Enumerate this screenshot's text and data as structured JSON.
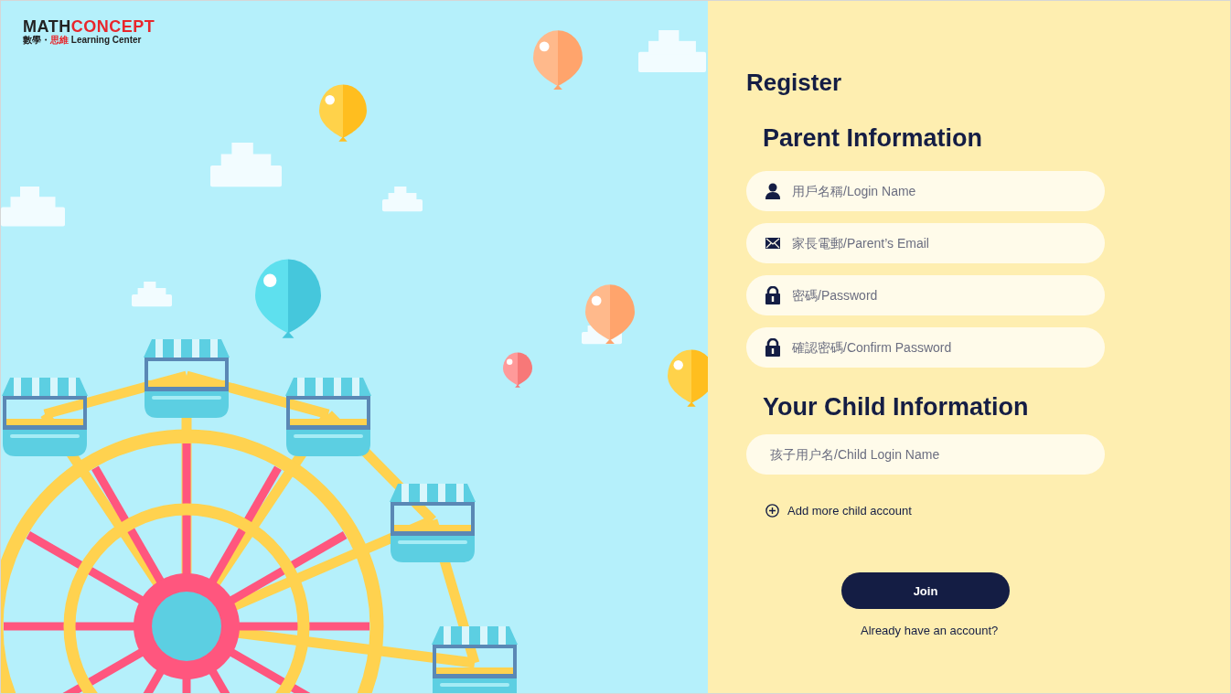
{
  "logo": {
    "brand_first": "MATH",
    "brand_second": "CONCEPT",
    "tagline_first": "數學・",
    "tagline_second": "思維",
    "tagline_third": "Learning Center"
  },
  "register": {
    "title": "Register",
    "sections": [
      {
        "heading": "Parent Information",
        "fields": [
          {
            "kind": "user",
            "placeholder": "用戶名稱/Login Name"
          },
          {
            "kind": "mail",
            "placeholder": "家長電郵/Parent’s Email"
          },
          {
            "kind": "lock",
            "placeholder": "密碼/Password"
          },
          {
            "kind": "lock",
            "placeholder": "確認密碼/Confirm Password"
          }
        ]
      },
      {
        "heading": "Your Child Information",
        "fields": [
          {
            "kind": "none",
            "placeholder": "孩子用户名/Child Login Name"
          }
        ]
      }
    ],
    "add_child": "Add more child account",
    "join_button": "Join",
    "login_link": "Already have an account?"
  }
}
